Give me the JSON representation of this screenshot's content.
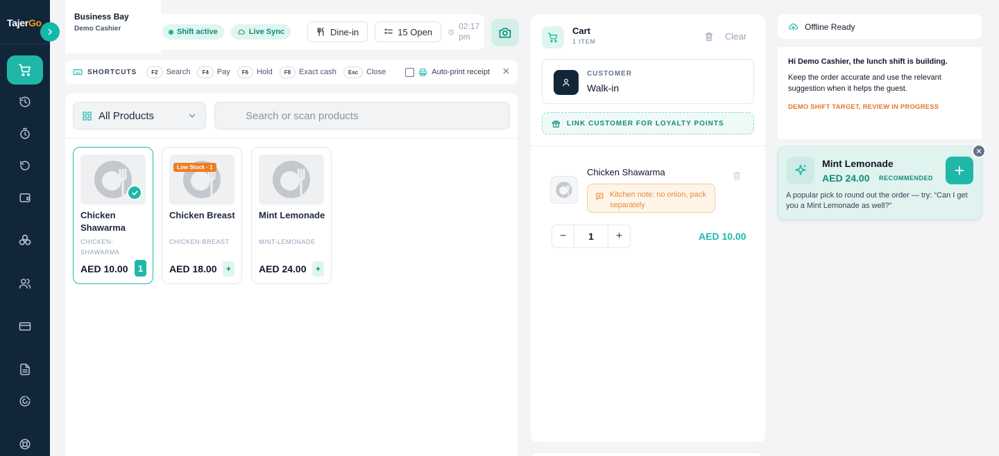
{
  "brand": {
    "name_main": "Tajer",
    "name_accent": "Go"
  },
  "business": {
    "name": "Business Bay",
    "user": "Demo Cashier"
  },
  "status": {
    "shift": "Shift active",
    "sync": "Live Sync",
    "order_type": "Dine-in",
    "open_orders": "15 Open",
    "time_line1": "02:17",
    "time_line2": "pm"
  },
  "shortcuts": {
    "title": "SHORTCUTS",
    "items": [
      {
        "key": "F2",
        "label": "Search"
      },
      {
        "key": "F4",
        "label": "Pay"
      },
      {
        "key": "F6",
        "label": "Hold"
      },
      {
        "key": "F8",
        "label": "Exact cash"
      },
      {
        "key": "Esc",
        "label": "Close"
      }
    ],
    "autoprint": "Auto-print receipt"
  },
  "catalog": {
    "category": "All Products",
    "search_placeholder": "Search or scan products",
    "products": [
      {
        "name": "Chicken Shawarma",
        "sku": "CHICKEN-SHAWARMA",
        "price": "AED 10.00",
        "qty": "1"
      },
      {
        "name": "Chicken Breast",
        "sku": "CHICKEN-BREAST",
        "price": "AED 18.00",
        "badge": "Low Stock · 1"
      },
      {
        "name": "Mint Lemonade",
        "sku": "MINT-LEMONADE",
        "price": "AED 24.00"
      }
    ]
  },
  "cart": {
    "title": "Cart",
    "subtitle": "1 ITEM",
    "clear": "Clear",
    "customer_label": "CUSTOMER",
    "customer_name": "Walk-in",
    "loyalty": "LINK CUSTOMER FOR LOYALTY POINTS",
    "items": [
      {
        "name": "Chicken Shawarma",
        "note": "Kitchen note: no onion, pack separately",
        "qty": "1",
        "total": "AED 10.00"
      }
    ]
  },
  "side": {
    "offline": "Offline Ready",
    "greeting": "Hi Demo Cashier, the lunch shift is building.",
    "message": "Keep the order accurate and use the relevant suggestion when it helps the guest.",
    "target": "DEMO SHIFT TARGET, REVIEW IN PROGRESS",
    "suggestion": {
      "name": "Mint Lemonade",
      "price": "AED 24.00",
      "tag": "RECOMMENDED",
      "text": "A popular pick to round out the order — try: “Can I get you a Mint Lemonade as well?”"
    }
  },
  "colors": {
    "accent": "#1fb8a8",
    "sidebar": "#12263a",
    "warning": "#ef7d1f"
  },
  "icons": [
    "cart-icon",
    "history-icon",
    "timer-icon",
    "refresh-icon",
    "wallet-icon",
    "modules-icon",
    "users-icon",
    "card-icon",
    "report-icon",
    "settings-icon",
    "support-icon"
  ]
}
